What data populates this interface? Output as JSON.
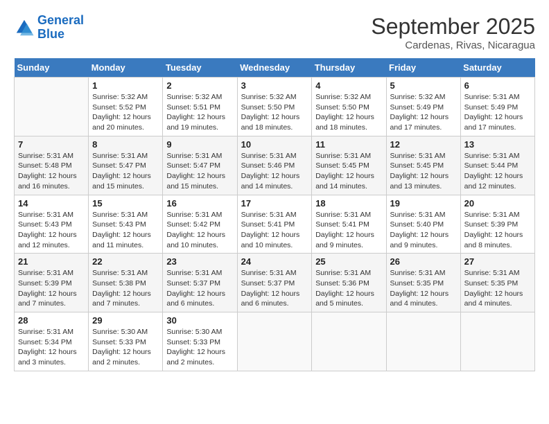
{
  "logo": {
    "line1": "General",
    "line2": "Blue"
  },
  "title": "September 2025",
  "subtitle": "Cardenas, Rivas, Nicaragua",
  "days_of_week": [
    "Sunday",
    "Monday",
    "Tuesday",
    "Wednesday",
    "Thursday",
    "Friday",
    "Saturday"
  ],
  "weeks": [
    [
      {
        "day": "",
        "text": ""
      },
      {
        "day": "1",
        "text": "Sunrise: 5:32 AM\nSunset: 5:52 PM\nDaylight: 12 hours\nand 20 minutes."
      },
      {
        "day": "2",
        "text": "Sunrise: 5:32 AM\nSunset: 5:51 PM\nDaylight: 12 hours\nand 19 minutes."
      },
      {
        "day": "3",
        "text": "Sunrise: 5:32 AM\nSunset: 5:50 PM\nDaylight: 12 hours\nand 18 minutes."
      },
      {
        "day": "4",
        "text": "Sunrise: 5:32 AM\nSunset: 5:50 PM\nDaylight: 12 hours\nand 18 minutes."
      },
      {
        "day": "5",
        "text": "Sunrise: 5:32 AM\nSunset: 5:49 PM\nDaylight: 12 hours\nand 17 minutes."
      },
      {
        "day": "6",
        "text": "Sunrise: 5:31 AM\nSunset: 5:49 PM\nDaylight: 12 hours\nand 17 minutes."
      }
    ],
    [
      {
        "day": "7",
        "text": "Sunrise: 5:31 AM\nSunset: 5:48 PM\nDaylight: 12 hours\nand 16 minutes."
      },
      {
        "day": "8",
        "text": "Sunrise: 5:31 AM\nSunset: 5:47 PM\nDaylight: 12 hours\nand 15 minutes."
      },
      {
        "day": "9",
        "text": "Sunrise: 5:31 AM\nSunset: 5:47 PM\nDaylight: 12 hours\nand 15 minutes."
      },
      {
        "day": "10",
        "text": "Sunrise: 5:31 AM\nSunset: 5:46 PM\nDaylight: 12 hours\nand 14 minutes."
      },
      {
        "day": "11",
        "text": "Sunrise: 5:31 AM\nSunset: 5:45 PM\nDaylight: 12 hours\nand 14 minutes."
      },
      {
        "day": "12",
        "text": "Sunrise: 5:31 AM\nSunset: 5:45 PM\nDaylight: 12 hours\nand 13 minutes."
      },
      {
        "day": "13",
        "text": "Sunrise: 5:31 AM\nSunset: 5:44 PM\nDaylight: 12 hours\nand 12 minutes."
      }
    ],
    [
      {
        "day": "14",
        "text": "Sunrise: 5:31 AM\nSunset: 5:43 PM\nDaylight: 12 hours\nand 12 minutes."
      },
      {
        "day": "15",
        "text": "Sunrise: 5:31 AM\nSunset: 5:43 PM\nDaylight: 12 hours\nand 11 minutes."
      },
      {
        "day": "16",
        "text": "Sunrise: 5:31 AM\nSunset: 5:42 PM\nDaylight: 12 hours\nand 10 minutes."
      },
      {
        "day": "17",
        "text": "Sunrise: 5:31 AM\nSunset: 5:41 PM\nDaylight: 12 hours\nand 10 minutes."
      },
      {
        "day": "18",
        "text": "Sunrise: 5:31 AM\nSunset: 5:41 PM\nDaylight: 12 hours\nand 9 minutes."
      },
      {
        "day": "19",
        "text": "Sunrise: 5:31 AM\nSunset: 5:40 PM\nDaylight: 12 hours\nand 9 minutes."
      },
      {
        "day": "20",
        "text": "Sunrise: 5:31 AM\nSunset: 5:39 PM\nDaylight: 12 hours\nand 8 minutes."
      }
    ],
    [
      {
        "day": "21",
        "text": "Sunrise: 5:31 AM\nSunset: 5:39 PM\nDaylight: 12 hours\nand 7 minutes."
      },
      {
        "day": "22",
        "text": "Sunrise: 5:31 AM\nSunset: 5:38 PM\nDaylight: 12 hours\nand 7 minutes."
      },
      {
        "day": "23",
        "text": "Sunrise: 5:31 AM\nSunset: 5:37 PM\nDaylight: 12 hours\nand 6 minutes."
      },
      {
        "day": "24",
        "text": "Sunrise: 5:31 AM\nSunset: 5:37 PM\nDaylight: 12 hours\nand 6 minutes."
      },
      {
        "day": "25",
        "text": "Sunrise: 5:31 AM\nSunset: 5:36 PM\nDaylight: 12 hours\nand 5 minutes."
      },
      {
        "day": "26",
        "text": "Sunrise: 5:31 AM\nSunset: 5:35 PM\nDaylight: 12 hours\nand 4 minutes."
      },
      {
        "day": "27",
        "text": "Sunrise: 5:31 AM\nSunset: 5:35 PM\nDaylight: 12 hours\nand 4 minutes."
      }
    ],
    [
      {
        "day": "28",
        "text": "Sunrise: 5:31 AM\nSunset: 5:34 PM\nDaylight: 12 hours\nand 3 minutes."
      },
      {
        "day": "29",
        "text": "Sunrise: 5:30 AM\nSunset: 5:33 PM\nDaylight: 12 hours\nand 2 minutes."
      },
      {
        "day": "30",
        "text": "Sunrise: 5:30 AM\nSunset: 5:33 PM\nDaylight: 12 hours\nand 2 minutes."
      },
      {
        "day": "",
        "text": ""
      },
      {
        "day": "",
        "text": ""
      },
      {
        "day": "",
        "text": ""
      },
      {
        "day": "",
        "text": ""
      }
    ]
  ]
}
